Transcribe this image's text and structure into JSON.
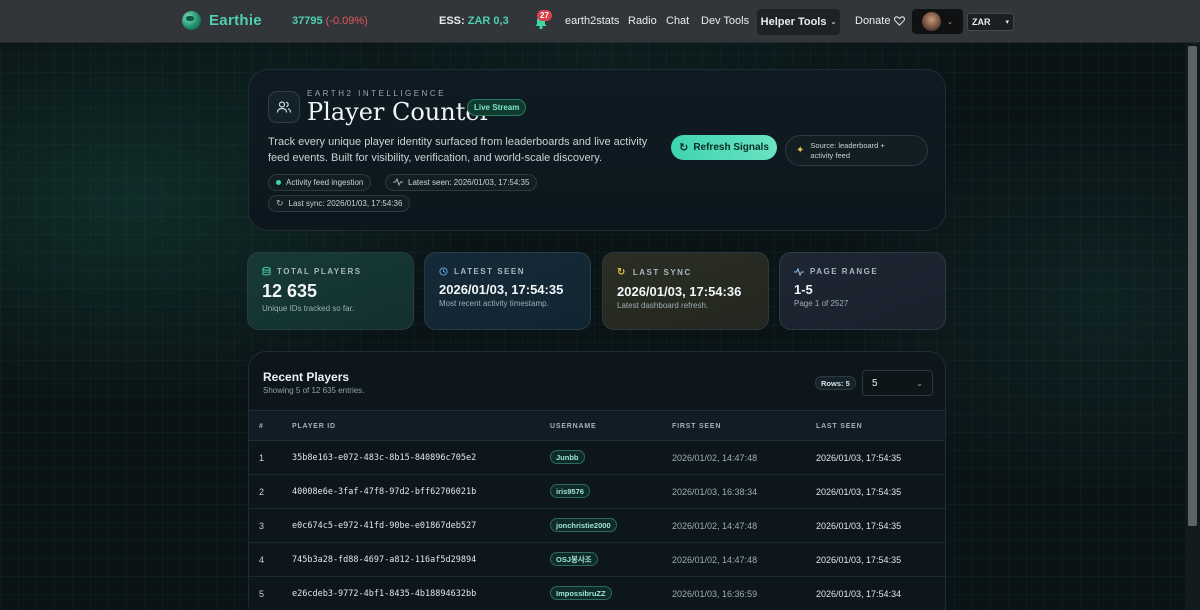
{
  "nav": {
    "logo_text": "Earthie",
    "price": "37795",
    "price_change": "(-0.09%)",
    "ess_label": "ESS:",
    "ess_value": "ZAR 0,3",
    "notif_count": "27",
    "links": [
      "earth2stats",
      "Radio",
      "Chat",
      "Dev Tools"
    ],
    "helper_tools": "Helper Tools",
    "donate": "Donate",
    "currency": "ZAR"
  },
  "hero": {
    "eyebrow": "EARTH2 INTELLIGENCE",
    "title": "Player Counter",
    "badge": "Live Stream",
    "description": "Track every unique player identity surfaced from leaderboards and live activity feed events. Built for visibility, verification, and world-scale discovery.",
    "chip_feed": "Activity feed ingestion",
    "chip_latest": "Latest seen: 2026/01/03, 17:54:35",
    "chip_sync": "Last sync: 2026/01/03, 17:54:36",
    "refresh_label": "Refresh Signals",
    "source_line1": "Source: leaderboard +",
    "source_line2": "activity feed"
  },
  "stats": {
    "total": {
      "label": "TOTAL PLAYERS",
      "value": "12 635",
      "sub": "Unique IDs tracked so far."
    },
    "latest": {
      "label": "LATEST SEEN",
      "value": "2026/01/03, 17:54:35",
      "sub": "Most recent activity timestamp."
    },
    "sync": {
      "label": "LAST SYNC",
      "value": "2026/01/03, 17:54:36",
      "sub": "Latest dashboard refresh."
    },
    "range": {
      "label": "PAGE RANGE",
      "value": "1-5",
      "sub": "Page 1 of 2527"
    }
  },
  "table": {
    "title": "Recent Players",
    "subtitle": "Showing 5 of 12 635 entries.",
    "rows_badge": "Rows: 5",
    "rows_value": "5",
    "headers": {
      "num": "#",
      "player_id": "PLAYER ID",
      "username": "USERNAME",
      "first_seen": "FIRST SEEN",
      "last_seen": "LAST SEEN"
    },
    "rows": [
      {
        "num": "1",
        "player_id": "35b8e163-e072-483c-8b15-840896c705e2",
        "username": "Junbb",
        "first_seen": "2026/01/02, 14:47:48",
        "last_seen": "2026/01/03, 17:54:35"
      },
      {
        "num": "2",
        "player_id": "40008e6e-3faf-47f8-97d2-bff62706021b",
        "username": "iris9576",
        "first_seen": "2026/01/03, 16:38:34",
        "last_seen": "2026/01/03, 17:54:35"
      },
      {
        "num": "3",
        "player_id": "e0c674c5-e972-41fd-90be-e01867deb527",
        "username": "jonchristie2000",
        "first_seen": "2026/01/02, 14:47:48",
        "last_seen": "2026/01/03, 17:54:35"
      },
      {
        "num": "4",
        "player_id": "745b3a28-fd88-4697-a812-116af5d29894",
        "username": "OSJ봉사조",
        "first_seen": "2026/01/02, 14:47:48",
        "last_seen": "2026/01/03, 17:54:35"
      },
      {
        "num": "5",
        "player_id": "e26cdeb3-9772-4bf1-8435-4b18894632bb",
        "username": "ImpossibruZZ",
        "first_seen": "2026/01/03, 16:36:59",
        "last_seen": "2026/01/03, 17:54:34"
      }
    ]
  },
  "colors": {
    "accent": "#4fd1b0",
    "negative": "#e05a5a",
    "background": "#0a1316"
  }
}
